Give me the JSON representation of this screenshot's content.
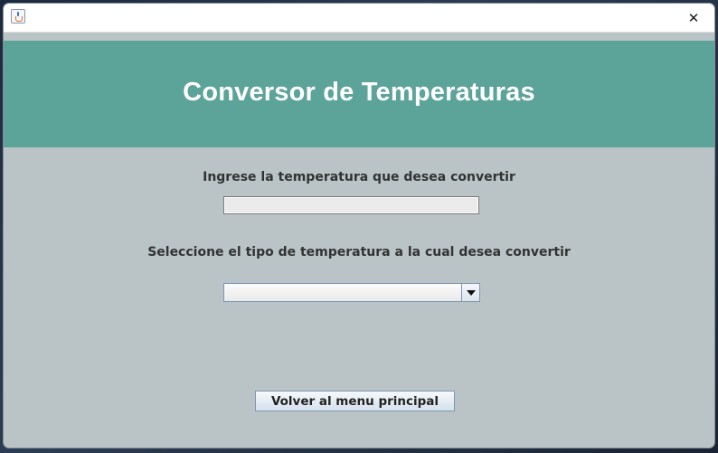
{
  "window": {
    "app_icon": "java-app-icon",
    "close_icon": "close-icon",
    "close_glyph": "✕"
  },
  "header": {
    "title": "Conversor de Temperaturas",
    "color": "#5ca39a"
  },
  "form": {
    "temperature_label": "Ingrese la temperatura que desea convertir",
    "temperature_value": "",
    "type_label": "Seleccione el tipo de temperatura a la cual desea convertir",
    "type_selected": "",
    "back_button_label": "Volver al menu principal"
  },
  "colors": {
    "window_bg": "#bac4c6",
    "header_bg": "#5ca39a",
    "button_border": "#7f96b2"
  }
}
